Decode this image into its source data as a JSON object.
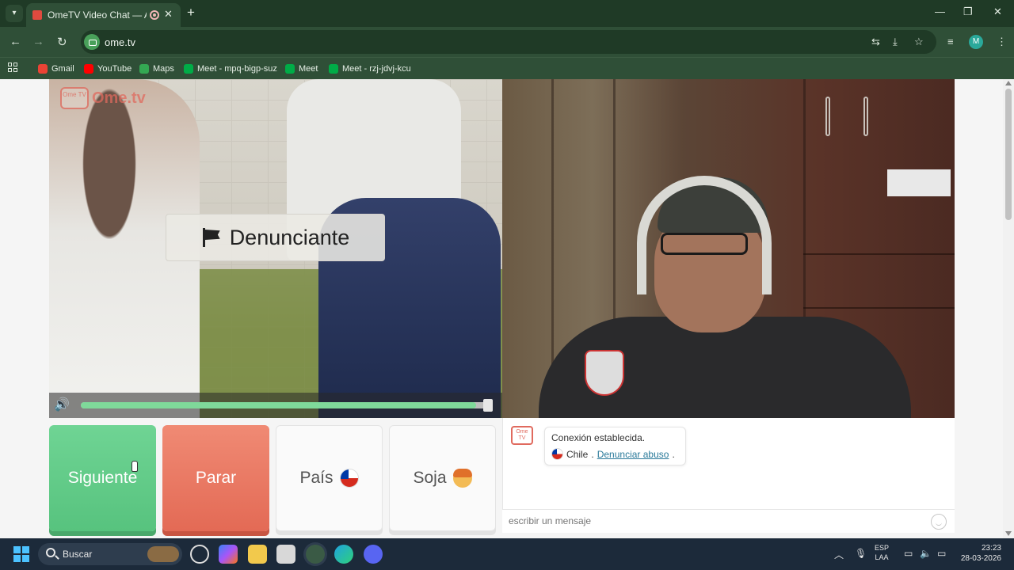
{
  "browser": {
    "tab_title": "OmeTV Video Chat — Alter",
    "url": "ome.tv",
    "profile_initial": "M",
    "bookmarks": [
      "Gmail",
      "YouTube",
      "Maps",
      "Meet - mpq-bigp-suz",
      "Meet",
      "Meet - rzj-jdvj-kcu"
    ]
  },
  "page": {
    "logo_text": "Ome.tv",
    "logo_badge": "Ome TV",
    "report_label": "Denunciante",
    "volume_level": 0.97
  },
  "buttons": {
    "next": "Siguiente",
    "stop": "Parar",
    "country": "País",
    "gender": "Soja"
  },
  "chat": {
    "connection_msg": "Conexión establecida.",
    "country": "Chile",
    "separator": ".",
    "report_link": "Denunciar abuso",
    "placeholder": "escribir un mensaje"
  },
  "taskbar": {
    "search_label": "Buscar",
    "lang_top": "ESP",
    "lang_bottom": "LAA",
    "time": "23:23",
    "date": "28-03-2026"
  },
  "colors": {
    "next_green": "#57c37e",
    "stop_red": "#e36a55",
    "link": "#2a7a9a",
    "chrome_green": "#2f4f37"
  }
}
